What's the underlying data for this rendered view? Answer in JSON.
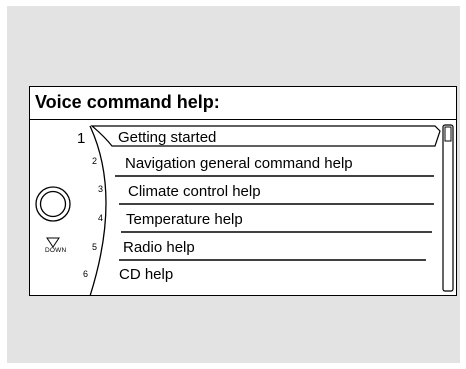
{
  "screen": {
    "title": "Voice command help:"
  },
  "menu": {
    "items": [
      {
        "number": "1",
        "label": "Getting started",
        "selected": true
      },
      {
        "number": "2",
        "label": "Navigation general command help",
        "selected": false
      },
      {
        "number": "3",
        "label": "Climate control help",
        "selected": false
      },
      {
        "number": "4",
        "label": "Temperature help",
        "selected": false
      },
      {
        "number": "5",
        "label": "Radio help",
        "selected": false
      },
      {
        "number": "6",
        "label": "CD help",
        "selected": false
      }
    ]
  },
  "controls": {
    "knob_icon": "dial-knob-icon",
    "down_arrow_icon": "down-triangle-icon",
    "down_label": "DOWN"
  },
  "colors": {
    "background": "#e3e3e3",
    "screen": "#ffffff",
    "ink": "#000000"
  }
}
